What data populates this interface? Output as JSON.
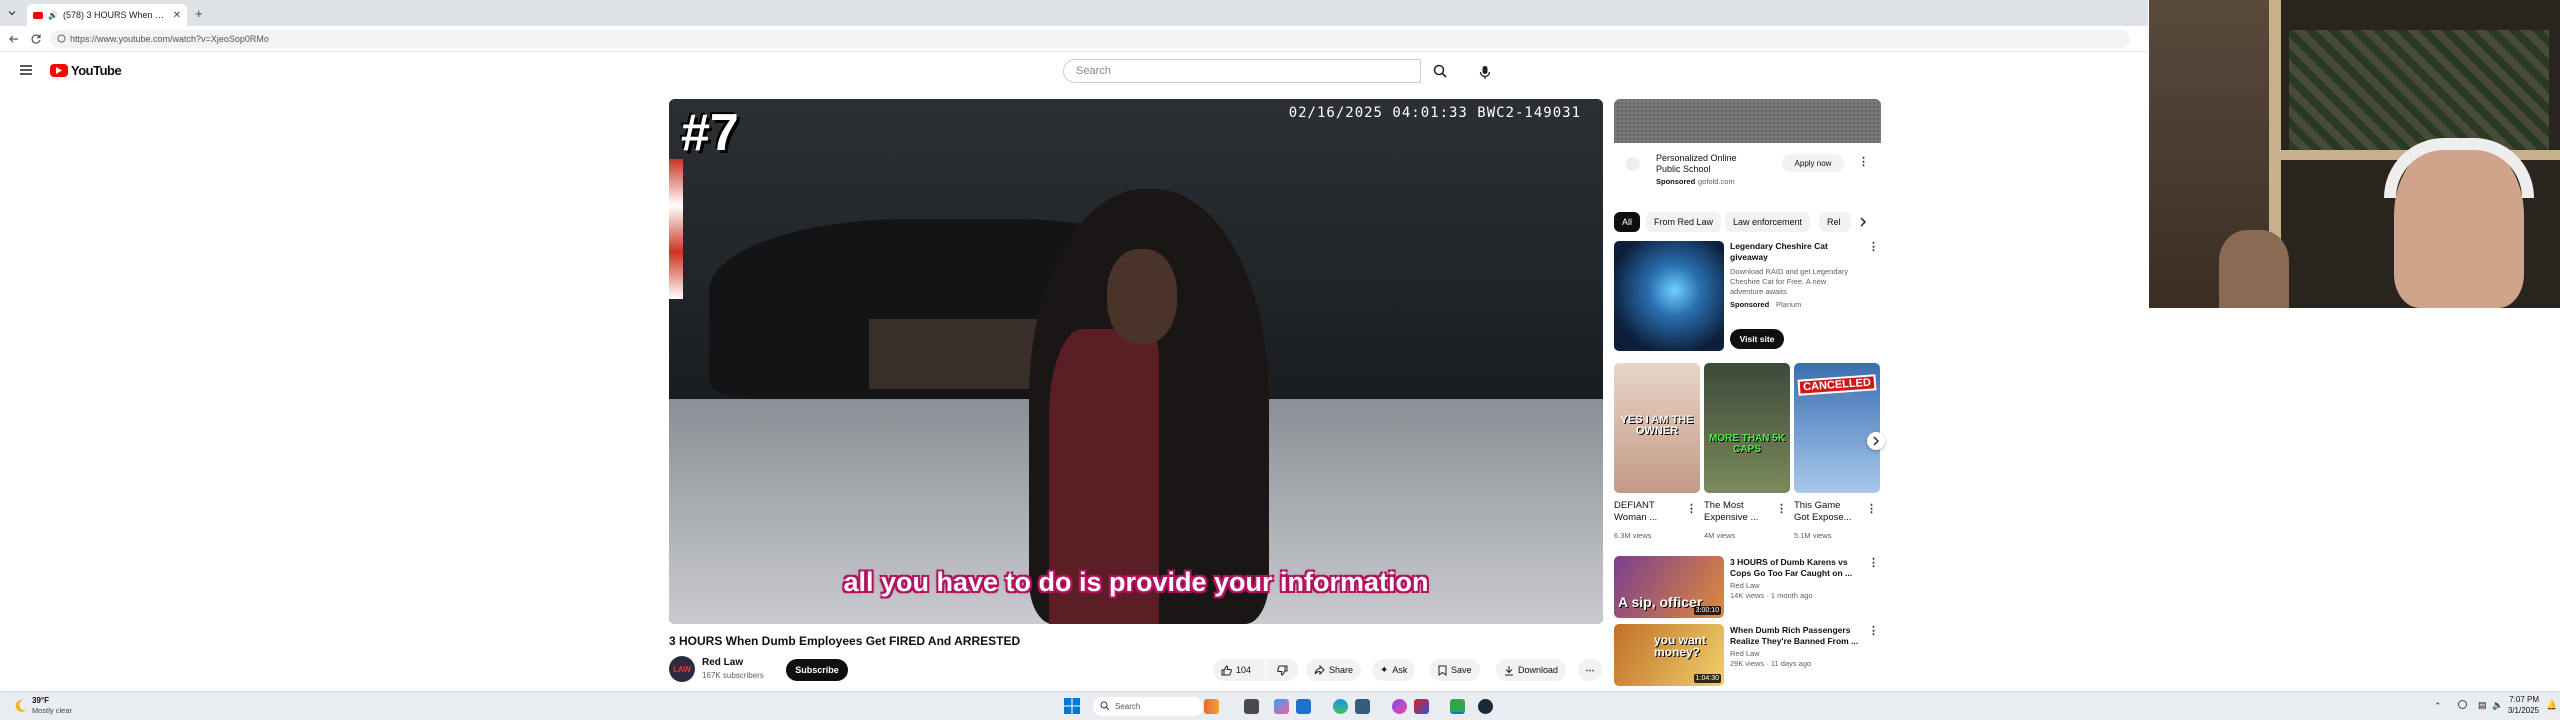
{
  "browser": {
    "tab_title": "(578) 3 HOURS When Dumb E",
    "url": "https://www.youtube.com/watch?v=XjeoSop0RMo"
  },
  "youtube": {
    "logo_text": "YouTube",
    "search_placeholder": "Search"
  },
  "video": {
    "overlay_number": "#7",
    "timestamp_overlay": "02/16/2025 04:01:33 BWC2-149031",
    "caption": "all you have to do is provide your information",
    "title": "3 HOURS When Dumb Employees Get FIRED And ARRESTED",
    "channel_name": "Red Law",
    "channel_avatar_text": "LAW",
    "subscribers": "167K subscribers",
    "subscribe_label": "Subscribe",
    "like_count": "104",
    "share_label": "Share",
    "ask_label": "Ask",
    "save_label": "Save",
    "download_label": "Download"
  },
  "sidebar": {
    "ad": {
      "title_line1": "Personalized Online",
      "title_line2": "Public School",
      "sponsored": "Sponsored",
      "domain": "gofold.com",
      "apply_label": "Apply now"
    },
    "chips": [
      "All",
      "From Red Law",
      "Law enforcement",
      "Rel"
    ],
    "promo": {
      "title_line1": "Legendary Cheshire Cat",
      "title_line2": "giveaway",
      "desc_line1": "Download RAID and get Legendary",
      "desc_line2": "Cheshire Cat for Free. A new",
      "desc_line3": "adventure awaits",
      "sponsored": "Sponsored",
      "advertiser": "Plarium",
      "visit_label": "Visit site"
    },
    "shorts": [
      {
        "title_line1": "DEFIANT",
        "title_line2": "Woman ...",
        "views": "6.3M views",
        "thumb_text": "YES I AM THE OWNER"
      },
      {
        "title_line1": "The Most",
        "title_line2": "Expensive ...",
        "views": "4M views",
        "thumb_text": "MORE THAN 5K CAPS"
      },
      {
        "title_line1": "This Game",
        "title_line2": "Got Expose...",
        "views": "5.1M views",
        "thumb_text": "CANCELLED"
      }
    ],
    "videos": [
      {
        "title_line1": "3 HOURS of Dumb Karens vs",
        "title_line2": "Cops Go Too Far Caught on ...",
        "channel": "Red Law",
        "meta": "14K views · 1 month ago",
        "duration": "3:00:10",
        "thumb_text": "A sip, officer"
      },
      {
        "title_line1": "When Dumb Rich Passengers",
        "title_line2": "Realize They're Banned From ...",
        "channel": "Red Law",
        "meta": "29K views · 11 days ago",
        "duration": "1:04:30",
        "thumb_text": "you want money?"
      }
    ]
  },
  "taskbar": {
    "weather_temp": "39°F",
    "weather_desc": "Mostly clear",
    "search_placeholder": "Search",
    "time": "7:07 PM",
    "date": "3/1/2025"
  },
  "colors": {
    "youtube_red": "#ff0000",
    "caption_magenta": "#b0105e"
  }
}
